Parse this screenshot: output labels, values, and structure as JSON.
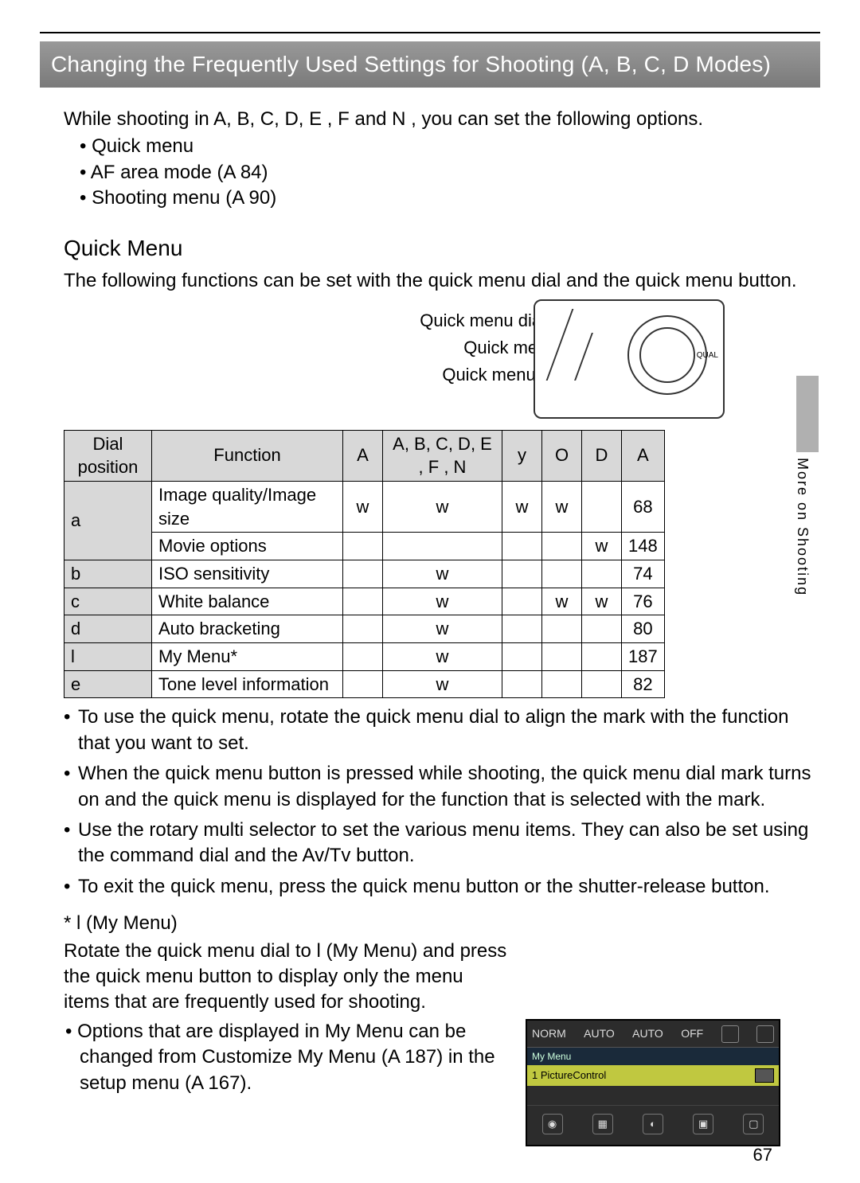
{
  "title": "Changing the Frequently Used Settings for Shooting (A, B, C, D  Modes)",
  "intro": {
    "line": "While shooting in A, B, C, D, E   , F     and N   , you can set the following options.",
    "items": [
      "Quick menu",
      "AF area mode (A  84)",
      "Shooting menu (A  90)"
    ]
  },
  "section": {
    "heading": "Quick Menu",
    "desc": "The following functions can be set with the quick menu dial and the quick menu button."
  },
  "dial_labels": {
    "mark": "Quick menu dial mark",
    "dial": "Quick menu dial",
    "button": "Quick menu button"
  },
  "dial_qual": "QUAL",
  "side_tab": "More on Shooting",
  "table": {
    "headers": [
      "Dial position",
      "Function",
      "A",
      "A, B, C, D, E  , F  , N",
      "y",
      "O",
      "D",
      "A"
    ],
    "rows": [
      {
        "dp": "a",
        "fn": "Image quality/Image size",
        "c3": "w",
        "c4": "w",
        "c5": "w",
        "c6": "w",
        "c7": "",
        "c8": "68",
        "rowspan": 2
      },
      {
        "dp": "",
        "fn": "Movie options",
        "c3": "",
        "c4": "",
        "c5": "",
        "c6": "",
        "c7": "w",
        "c8": "148"
      },
      {
        "dp": "b",
        "fn": "ISO sensitivity",
        "c3": "",
        "c4": "w",
        "c5": "",
        "c6": "",
        "c7": "",
        "c8": "74"
      },
      {
        "dp": "c",
        "fn": "White balance",
        "c3": "",
        "c4": "w",
        "c5": "",
        "c6": "w",
        "c7": "w",
        "c8": "76"
      },
      {
        "dp": "d",
        "fn": "Auto bracketing",
        "c3": "",
        "c4": "w",
        "c5": "",
        "c6": "",
        "c7": "",
        "c8": "80"
      },
      {
        "dp": "l",
        "fn": "My Menu*",
        "c3": "",
        "c4": "w",
        "c5": "",
        "c6": "",
        "c7": "",
        "c8": "187"
      },
      {
        "dp": "e",
        "fn": "Tone level information",
        "c3": "",
        "c4": "w",
        "c5": "",
        "c6": "",
        "c7": "",
        "c8": "82"
      }
    ]
  },
  "bullets": [
    "To use the quick menu, rotate the quick menu dial to align the mark with the function that you want to set.",
    "When the quick menu button is pressed while shooting, the quick menu dial mark turns on and the quick menu is displayed for the function that is selected with the mark.",
    "Use the rotary multi selector to set the various menu items. They can also be set using the command dial and the Av/Tv button.",
    "To exit the quick menu, press the quick menu button or the shutter-release button."
  ],
  "mymenu": {
    "head": "* l    (My Menu)",
    "body": "Rotate the quick menu dial to l  (My Menu) and press the quick menu button to display only the menu items that are frequently used for shooting.",
    "sub": "Options that are displayed in My Menu can be changed from Customize My Menu (A  187) in the setup menu (A  167)."
  },
  "lcd": {
    "top": [
      "NORM",
      "AUTO",
      "AUTO",
      "OFF"
    ],
    "label": "My Menu",
    "sel_num": "1",
    "sel_text": "PictureControl"
  },
  "page_number": "67"
}
